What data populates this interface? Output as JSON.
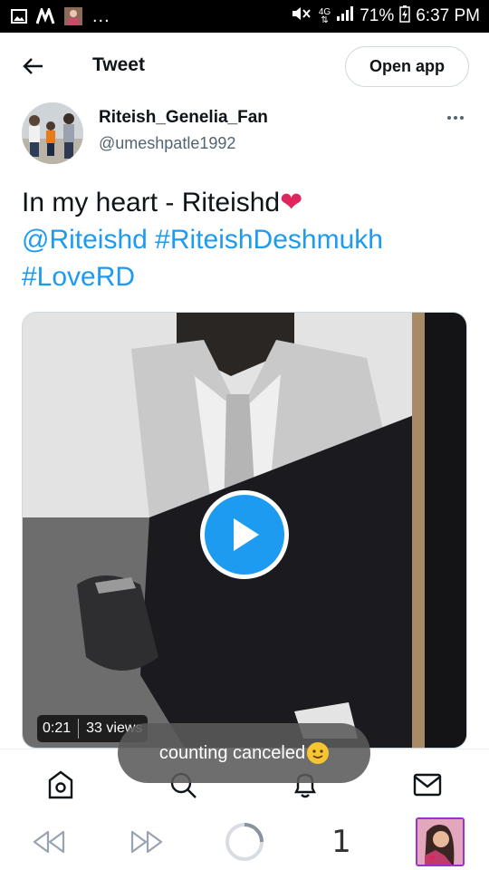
{
  "status_bar": {
    "notification_icons": [
      "image-icon",
      "media-app-icon",
      "profile-thumb-icon"
    ],
    "overflow": "...",
    "network_label": "4G",
    "battery": "71%",
    "time": "6:37 PM"
  },
  "header": {
    "title": "Tweet",
    "open_app_label": "Open app"
  },
  "author": {
    "name": "Riteish_Genelia_Fan",
    "handle": "@umeshpatle1992"
  },
  "tweet": {
    "line1": "In my heart - Riteishd",
    "heart_emoji": "❤",
    "line2": "@Riteishd #RiteishDeshmukh",
    "line3": "#LoveRD"
  },
  "media": {
    "duration": "0:21",
    "views": "33 views"
  },
  "toast": {
    "text": "counting canceled"
  },
  "browser": {
    "tab_count": "1"
  },
  "colors": {
    "accent": "#1d9bf0",
    "heart": "#e0245e",
    "tab_thumb_border": "#9b33c9"
  }
}
